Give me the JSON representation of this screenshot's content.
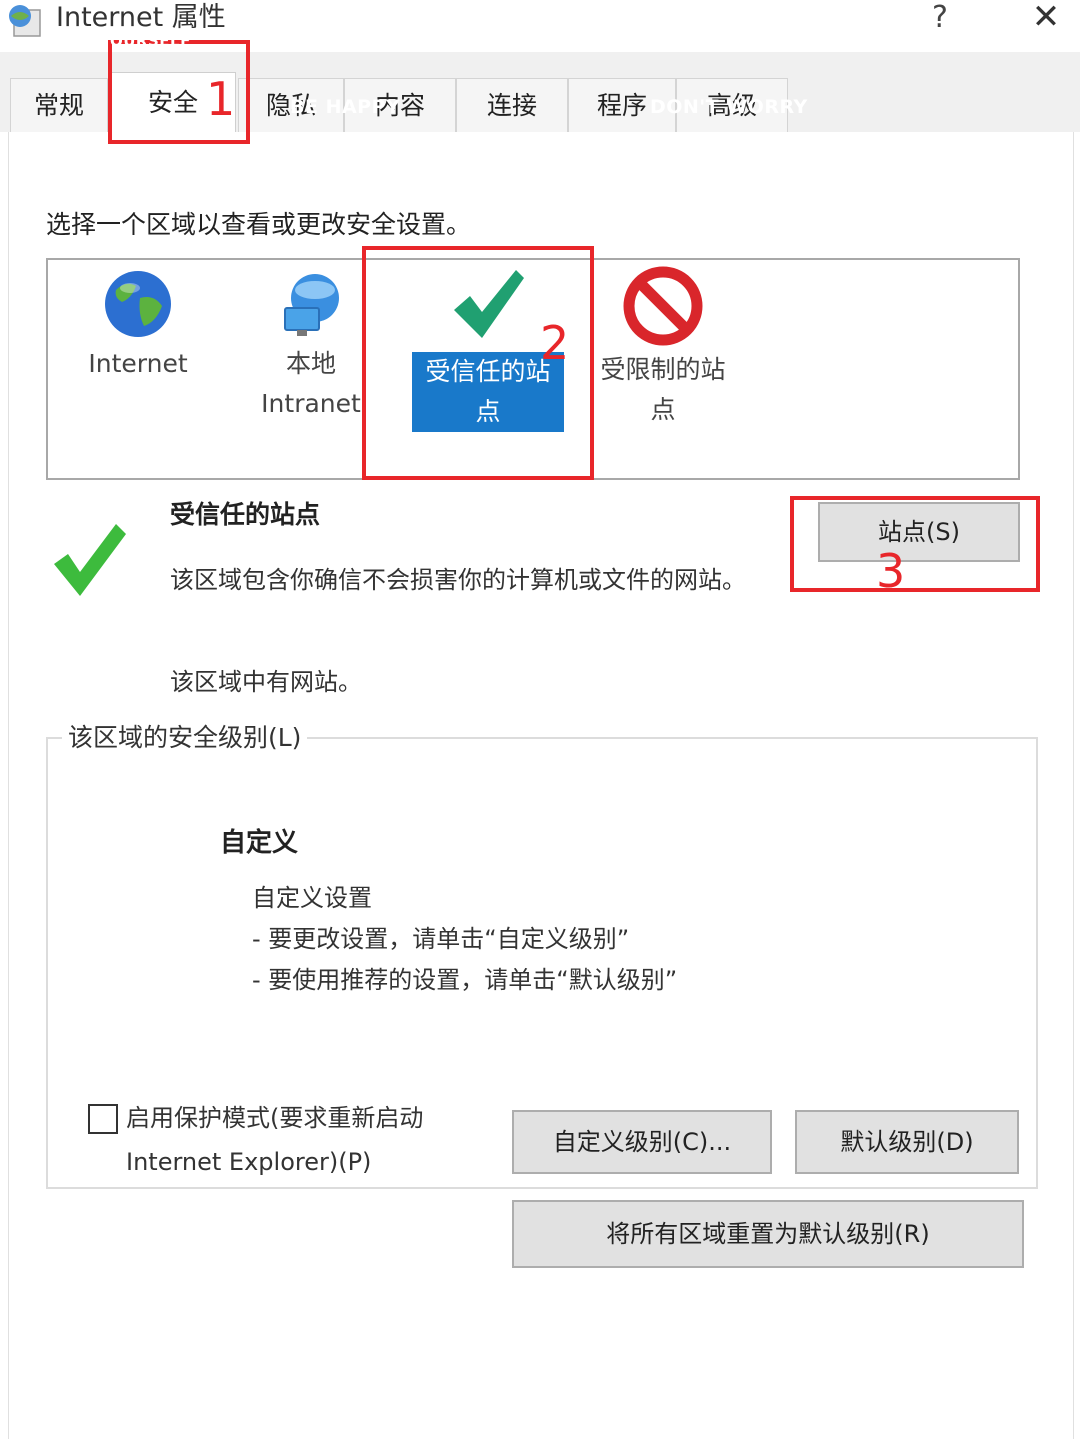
{
  "window": {
    "title": "Internet 属性",
    "help_label": "?",
    "close_label": "✕"
  },
  "tabs": [
    {
      "label": "常规"
    },
    {
      "label": "安全"
    },
    {
      "label": "隐私"
    },
    {
      "label": "内容"
    },
    {
      "label": "连接"
    },
    {
      "label": "程序"
    },
    {
      "label": "高级"
    }
  ],
  "security": {
    "instruction": "选择一个区域以查看或更改安全设置。",
    "zones": [
      {
        "label_line1": "Internet",
        "label_line2": "",
        "icon": "globe-icon"
      },
      {
        "label_line1": "本地",
        "label_line2": "Intranet",
        "icon": "network-icon"
      },
      {
        "label_line1": "受信任的站",
        "label_line2": "点",
        "icon": "checkmark-icon"
      },
      {
        "label_line1": "受限制的站",
        "label_line2": "点",
        "icon": "restricted-icon"
      }
    ],
    "selected_zone": {
      "title": "受信任的站点",
      "description": "该区域包含你确信不会损害你的计算机或文件的网站。",
      "sites_note": "该区域中有网站。",
      "sites_button": "站点(S)"
    },
    "level_group": {
      "title": "该区域的安全级别(L)",
      "level_name": "自定义",
      "desc_line1": "自定义设置",
      "desc_line2": "- 要更改设置，请单击“自定义级别”",
      "desc_line3": "- 要使用推荐的设置，请单击“默认级别”"
    },
    "protected_mode_label": "启用保护模式(要求重新启动 Internet Explorer)(P)",
    "protected_mode_checked": false,
    "custom_level_button": "自定义级别(C)...",
    "default_level_button": "默认级别(D)",
    "reset_all_button": "将所有区域重置为默认级别(R)"
  },
  "annotations": {
    "marker1": "1",
    "marker2": "2",
    "marker3": "3",
    "color": "#e8262a"
  },
  "overlay_texts": {
    "top": "OURSELF",
    "mid": "BE HAPPY",
    "right": "DON'T WORRY"
  },
  "colors": {
    "selection": "#1979ca",
    "check_green": "#3dbb3d",
    "restricted_red": "#d9262b"
  }
}
